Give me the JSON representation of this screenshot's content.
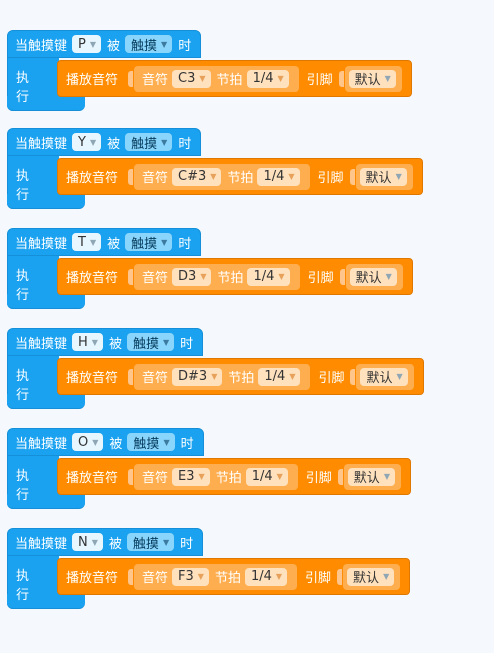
{
  "labels": {
    "when": "当触摸键",
    "is": "被",
    "when_suffix": "时",
    "execute": "执行",
    "play": "播放音符",
    "note": "音符",
    "beat": "节拍",
    "pin": "引脚"
  },
  "colors": {
    "event_blue": "#1aa2f0",
    "command_orange": "#ff8c00",
    "inner_orange": "#ffae4f"
  },
  "blocks": [
    {
      "key": "P",
      "state": "触摸",
      "note": "C3",
      "beat": "1/4",
      "pin": "默认"
    },
    {
      "key": "Y",
      "state": "触摸",
      "note": "C#3",
      "beat": "1/4",
      "pin": "默认"
    },
    {
      "key": "T",
      "state": "触摸",
      "note": "D3",
      "beat": "1/4",
      "pin": "默认"
    },
    {
      "key": "H",
      "state": "触摸",
      "note": "D#3",
      "beat": "1/4",
      "pin": "默认"
    },
    {
      "key": "O",
      "state": "触摸",
      "note": "E3",
      "beat": "1/4",
      "pin": "默认"
    },
    {
      "key": "N",
      "state": "触摸",
      "note": "F3",
      "beat": "1/4",
      "pin": "默认"
    }
  ]
}
